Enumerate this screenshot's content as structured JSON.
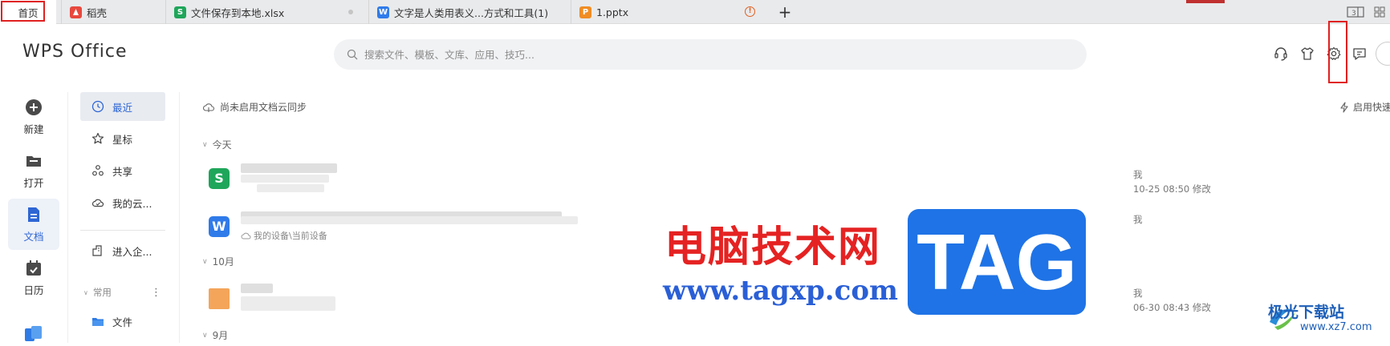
{
  "tabs": [
    {
      "label": "首页",
      "icon": "home"
    },
    {
      "label": "稻壳",
      "icon": "docer-icon",
      "color": "#e8483d"
    },
    {
      "label": "文件保存到本地.xlsx",
      "icon": "spreadsheet-icon",
      "color": "#1fa65a"
    },
    {
      "label": "文字是人类用表义...方式和工具(1)",
      "icon": "writer-icon",
      "color": "#2f7bea"
    },
    {
      "label": "1.pptx",
      "icon": "presentation-icon",
      "color": "#f08d24"
    }
  ],
  "header": {
    "logo": "WPS Office",
    "search_placeholder": "搜索文件、模板、文库、应用、技巧..."
  },
  "rail": [
    {
      "label": "新建",
      "icon": "plus-circle-icon"
    },
    {
      "label": "打开",
      "icon": "folder-icon"
    },
    {
      "label": "文档",
      "icon": "document-icon",
      "active": true
    },
    {
      "label": "日历",
      "icon": "calendar-icon"
    }
  ],
  "nav2": {
    "items": [
      {
        "label": "最近",
        "icon": "clock-icon",
        "active": true
      },
      {
        "label": "星标",
        "icon": "star-icon"
      },
      {
        "label": "共享",
        "icon": "share-icon"
      },
      {
        "label": "我的云...",
        "icon": "cloud-icon"
      },
      {
        "label": "进入企...",
        "icon": "enterprise-icon"
      }
    ],
    "group_label": "常用",
    "group_more": "⋮",
    "folder_label": "文件"
  },
  "main": {
    "cloud_sync": "尚未启用文档云同步",
    "quick_enable": "启用快速",
    "groups": [
      {
        "label": "今天"
      },
      {
        "label": "10月"
      },
      {
        "label": "9月"
      }
    ],
    "files": [
      {
        "sub": "",
        "owner": "我",
        "mtime": "10-25 08:50 修改"
      },
      {
        "sub": "我的设备\\当前设备",
        "owner": "我",
        "mtime": ""
      },
      {
        "sub": "",
        "owner": "我",
        "mtime": "06-30 08:43 修改"
      }
    ]
  },
  "watermark": {
    "cn": "电脑技术网",
    "url": "www.tagxp.com",
    "tag": "TAG",
    "site": "极光下载站",
    "site_url": "www.xz7.com"
  },
  "colors": {
    "accent": "#2e66d4",
    "highlight": "#e02020"
  }
}
